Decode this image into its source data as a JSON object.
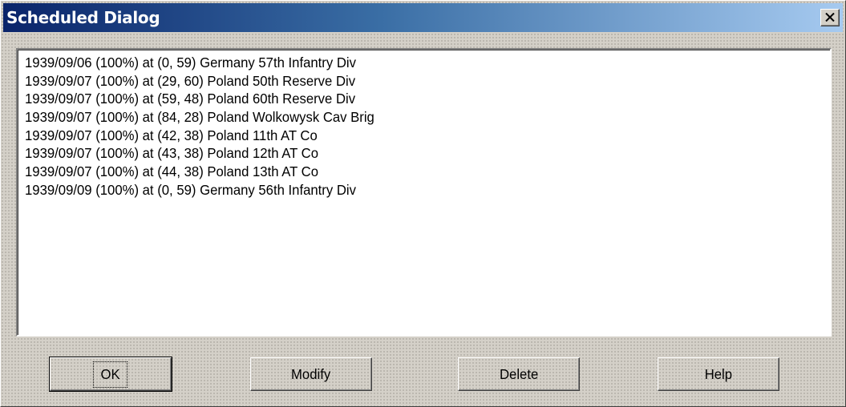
{
  "window": {
    "title": "Scheduled Dialog"
  },
  "list": {
    "items": [
      "1939/09/06 (100%) at (0, 59) Germany 57th Infantry Div",
      "1939/09/07 (100%) at (29, 60) Poland 50th Reserve Div",
      "1939/09/07 (100%) at (59, 48) Poland 60th Reserve Div",
      "1939/09/07 (100%) at (84, 28) Poland Wolkowysk Cav Brig",
      "1939/09/07 (100%) at (42, 38) Poland 11th AT Co",
      "1939/09/07 (100%) at (43, 38) Poland 12th AT Co",
      "1939/09/07 (100%) at (44, 38) Poland 13th AT Co",
      "1939/09/09 (100%) at (0, 59) Germany 56th Infantry Div"
    ]
  },
  "buttons": {
    "ok": "OK",
    "modify": "Modify",
    "delete": "Delete",
    "help": "Help"
  },
  "icons": {
    "close": "close-icon"
  },
  "colors": {
    "titlebar_start": "#0a246a",
    "titlebar_end": "#a6caf0",
    "face": "#d4d0c8"
  }
}
